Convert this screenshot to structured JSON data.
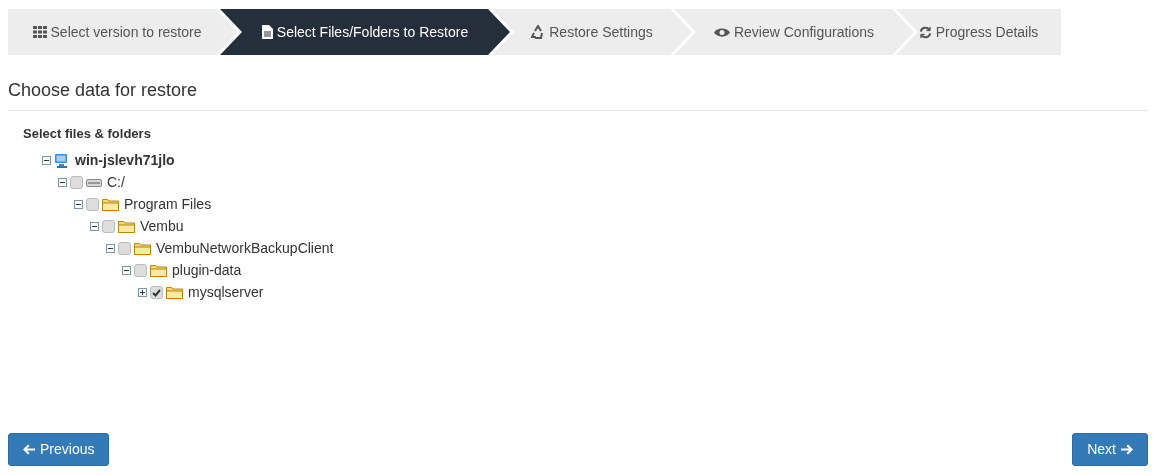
{
  "steps": [
    {
      "label": "Select version to restore",
      "selected": false
    },
    {
      "label": "Select Files/Folders to Restore",
      "selected": true
    },
    {
      "label": "Restore Settings",
      "selected": false
    },
    {
      "label": "Review Configurations",
      "selected": false
    },
    {
      "label": "Progress Details",
      "selected": false
    }
  ],
  "heading": "Choose data for restore",
  "tree_label": "Select files & folders",
  "tree": [
    {
      "label": "win-jslevh71jlo",
      "kind": "computer",
      "expanded": true,
      "children": [
        {
          "label": "C:/",
          "kind": "drive",
          "expanded": true,
          "checked": false,
          "children": [
            {
              "label": "Program Files",
              "kind": "folder",
              "expanded": true,
              "checked": false,
              "children": [
                {
                  "label": "Vembu",
                  "kind": "folder",
                  "expanded": true,
                  "checked": false,
                  "children": [
                    {
                      "label": "VembuNetworkBackupClient",
                      "kind": "folder",
                      "expanded": true,
                      "checked": false,
                      "children": [
                        {
                          "label": "plugin-data",
                          "kind": "folder",
                          "expanded": true,
                          "checked": false,
                          "children": [
                            {
                              "label": "mysqlserver",
                              "kind": "folder",
                              "expanded": false,
                              "checked": true
                            }
                          ]
                        }
                      ]
                    }
                  ]
                }
              ]
            }
          ]
        }
      ]
    }
  ],
  "buttons": {
    "previous": "Previous",
    "next": "Next"
  }
}
